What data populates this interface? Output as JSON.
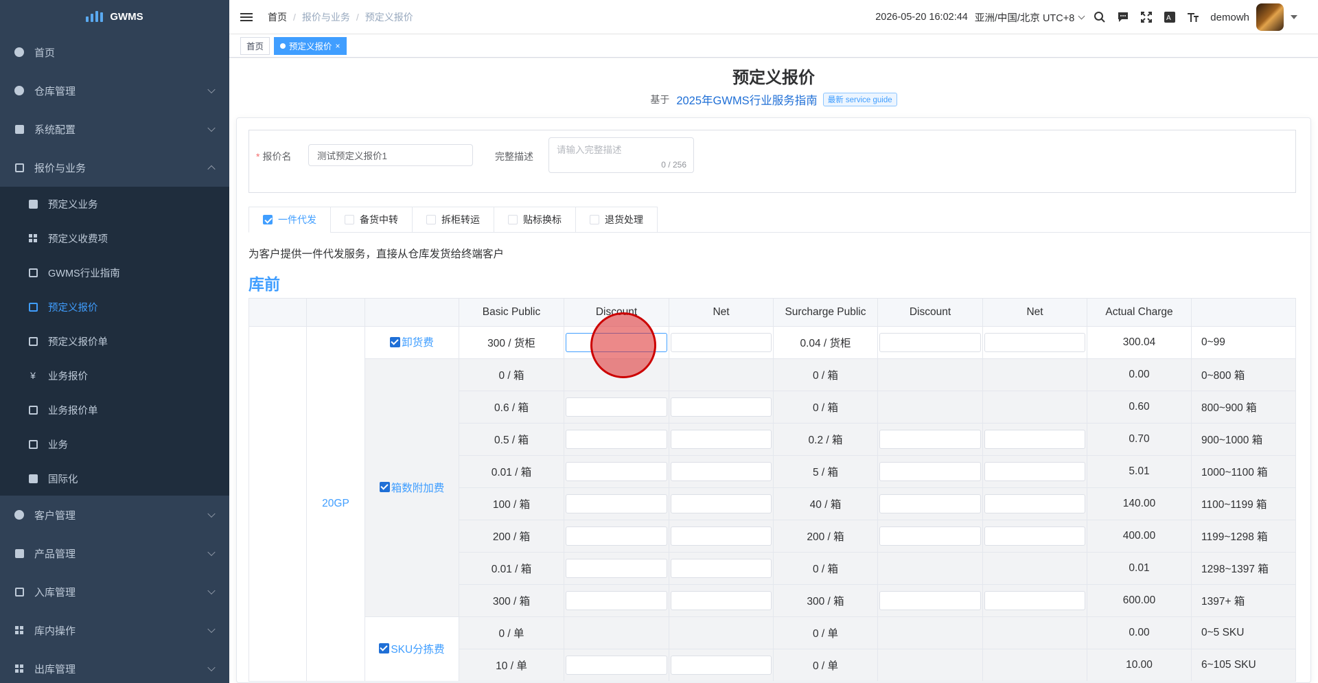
{
  "app": {
    "name": "GWMS"
  },
  "sidebar": {
    "items": [
      {
        "label": "首页",
        "icon": "dashboard-icon"
      },
      {
        "label": "仓库管理",
        "icon": "warehouse-icon"
      },
      {
        "label": "系统配置",
        "icon": "config-icon"
      },
      {
        "label": "报价与业务",
        "icon": "quote-icon",
        "expanded": true
      },
      {
        "label": "客户管理",
        "icon": "user-icon"
      },
      {
        "label": "产品管理",
        "icon": "cart-icon"
      },
      {
        "label": "入库管理",
        "icon": "home-icon"
      },
      {
        "label": "库内操作",
        "icon": "grid-icon"
      },
      {
        "label": "出库管理",
        "icon": "apps-icon"
      }
    ],
    "sub_items": [
      {
        "label": "预定义业务"
      },
      {
        "label": "预定义收费项"
      },
      {
        "label": "GWMS行业指南"
      },
      {
        "label": "预定义报价",
        "active": true
      },
      {
        "label": "预定义报价单"
      },
      {
        "label": "业务报价"
      },
      {
        "label": "业务报价单"
      },
      {
        "label": "业务"
      },
      {
        "label": "国际化"
      }
    ]
  },
  "header": {
    "breadcrumb": [
      "首页",
      "报价与业务",
      "预定义报价"
    ],
    "datetime": "2026-05-20 16:02:44",
    "timezone": "亚洲/中国/北京 UTC+8",
    "username": "demowh"
  },
  "tags": {
    "home": "首页",
    "active": "预定义报价",
    "close": "×"
  },
  "page": {
    "title": "预定义报价",
    "based_on": "基于",
    "guide_link": "2025年GWMS行业服务指南",
    "guide_badge": "最新 service guide",
    "quote_name_label": "报价名",
    "quote_name_value": "测试预定义报价1",
    "desc_label": "完整描述",
    "desc_placeholder": "请输入完整描述",
    "desc_count": "0 / 256",
    "tabs": [
      {
        "label": "一件代发",
        "checked": true
      },
      {
        "label": "备货中转",
        "checked": false
      },
      {
        "label": "拆柜转运",
        "checked": false
      },
      {
        "label": "贴标换标",
        "checked": false
      },
      {
        "label": "退货处理",
        "checked": false
      }
    ],
    "tab_desc": "为客户提供一件代发服务，直接从仓库发货给终端客户",
    "section": "库前"
  },
  "table": {
    "headers": [
      "Basic Public",
      "Discount",
      "Net",
      "Surcharge Public",
      "Discount",
      "Net",
      "Actual Charge"
    ],
    "group": "20GP",
    "categories": {
      "unload": "卸货费",
      "box": "箱数附加费",
      "sku": "SKU分拣费"
    },
    "rows": [
      {
        "basic": "300 / 货柜",
        "surcharge": "0.04 / 货柜",
        "actual": "300.04",
        "range": "0~99"
      },
      {
        "basic": "0 / 箱",
        "surcharge": "0 / 箱",
        "actual": "0.00",
        "range": "0~800 箱"
      },
      {
        "basic": "0.6 / 箱",
        "surcharge": "0 / 箱",
        "actual": "0.60",
        "range": "800~900 箱"
      },
      {
        "basic": "0.5 / 箱",
        "surcharge": "0.2 / 箱",
        "actual": "0.70",
        "range": "900~1000 箱"
      },
      {
        "basic": "0.01 / 箱",
        "surcharge": "5 / 箱",
        "actual": "5.01",
        "range": "1000~1100 箱"
      },
      {
        "basic": "100 / 箱",
        "surcharge": "40 / 箱",
        "actual": "140.00",
        "range": "1100~1199 箱"
      },
      {
        "basic": "200 / 箱",
        "surcharge": "200 / 箱",
        "actual": "400.00",
        "range": "1199~1298 箱"
      },
      {
        "basic": "0.01 / 箱",
        "surcharge": "0 / 箱",
        "actual": "0.01",
        "range": "1298~1397 箱"
      },
      {
        "basic": "300 / 箱",
        "surcharge": "300 / 箱",
        "actual": "600.00",
        "range": "1397+ 箱"
      },
      {
        "basic": "0 / 单",
        "surcharge": "0 / 单",
        "actual": "0.00",
        "range": "0~5 SKU"
      },
      {
        "basic": "10 / 单",
        "surcharge": "0 / 单",
        "actual": "10.00",
        "range": "6~105 SKU"
      }
    ]
  }
}
